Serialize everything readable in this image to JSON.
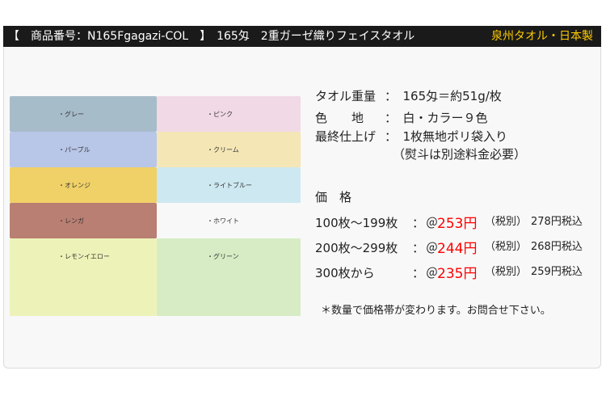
{
  "header": {
    "title": "【　商品番号：N165Fgagazi-COL　】　165匁　2重ガーゼ織りフェイスタオル",
    "brand": "泉州タオル・日本製"
  },
  "swatches": [
    {
      "label": "・グレー",
      "color": "#a7bcc9"
    },
    {
      "label": "・ピンク",
      "color": "#f1d9e6"
    },
    {
      "label": "・パープル",
      "color": "#b8c6e8"
    },
    {
      "label": "・クリーム",
      "color": "#f4e6b5"
    },
    {
      "label": "・オレンジ",
      "color": "#f0d167"
    },
    {
      "label": "・ライトブルー",
      "color": "#cde8f1"
    },
    {
      "label": "・レンガ",
      "color": "#b97f72"
    },
    {
      "label": "・ホワイト",
      "color": "#f8f8f8"
    },
    {
      "label": "・レモンイエロー",
      "color": "#edf3b8"
    },
    {
      "label": "・グリーン",
      "color": "#d7ecc5"
    }
  ],
  "specs": {
    "weight_label": "タオル重量",
    "weight_value": "：　165匁＝約51g/枚",
    "color_label": "色　　地",
    "color_value": "：　白・カラー９色",
    "finish_label": "最終仕上げ",
    "finish_value": "：　1枚無地ポリ袋入り",
    "finish_note": "（熨斗は別途料金必要）"
  },
  "pricing": {
    "heading": "価　格",
    "rows": [
      {
        "qty": "100枚～199枚",
        "colon": "：",
        "at": "＠",
        "price": "253円",
        "note": "（税別）",
        "incl": "278円税込"
      },
      {
        "qty": "200枚～299枚",
        "colon": "：",
        "at": "＠",
        "price": "244円",
        "note": "（税別）",
        "incl": "268円税込"
      },
      {
        "qty": "300枚から",
        "colon": "：",
        "at": "＠",
        "price": "235円",
        "note": "（税別）",
        "incl": "259円税込"
      }
    ],
    "footnote": "＊数量で価格帯が変わります。お問合せ下さい。"
  }
}
